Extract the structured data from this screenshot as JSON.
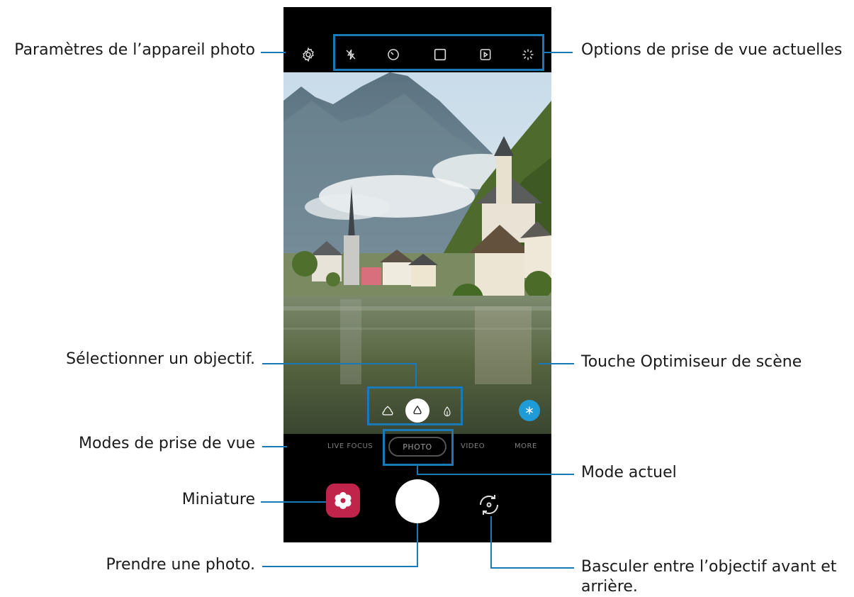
{
  "callouts": {
    "settings": "Paramètres de l’appareil photo",
    "current_options": "Options de prise de vue actuelles",
    "select_lens": "Sélectionner un objectif.",
    "scene_optimizer": "Touche Optimiseur de scène",
    "shooting_modes": "Modes de prise de vue",
    "current_mode": "Mode actuel",
    "thumbnail": "Miniature",
    "take_photo": "Prendre une photo.",
    "switch_lens_line1": "Basculer entre l’objectif avant et",
    "switch_lens_line2": "arrière."
  },
  "camera": {
    "modes": [
      "LIVE FOCUS",
      "PHOTO",
      "VIDEO",
      "MORE"
    ],
    "current_mode": "PHOTO",
    "top_icons": [
      "settings-icon",
      "flash-off-icon",
      "timer-icon",
      "aspect-ratio-icon",
      "motion-photo-icon",
      "filter-icon"
    ],
    "lens_icons": [
      "ultra-wide-lens-icon",
      "wide-lens-icon",
      "telephoto-lens-icon"
    ],
    "colors": {
      "accent": "#1a79b7",
      "scene_optimizer": "#1f9bd7",
      "gallery_thumb": "#c0244b",
      "shutter": "#ffffff"
    }
  }
}
